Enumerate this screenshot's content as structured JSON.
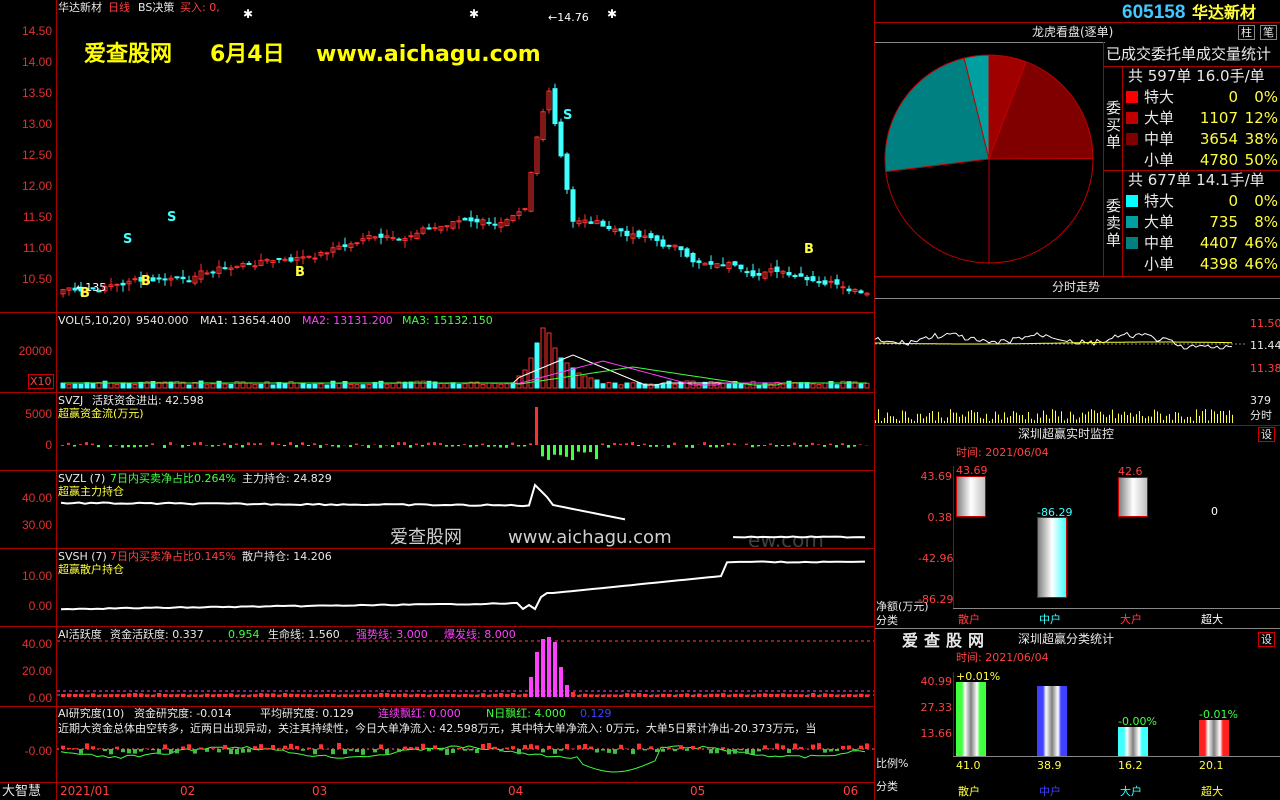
{
  "header": {
    "stock_name": "华达新材",
    "period": "日线",
    "bs_label": "BS决策",
    "buy_label": "买入: 0,",
    "code": "605158",
    "name2": "华达新材",
    "btn1": "柱",
    "btn2": "笔"
  },
  "watermark": {
    "site": "爱查股网",
    "date": "6月4日",
    "url": "www.aichagu.com",
    "mid": "爱查股网",
    "mid_url": "www.aichagu.com",
    "faint": "ew.com"
  },
  "price_axis": [
    "14.50",
    "14.00",
    "13.50",
    "13.00",
    "12.50",
    "12.00",
    "11.50",
    "11.00",
    "10.50"
  ],
  "price_high": "14.76",
  "price_low": "35",
  "marks": {
    "B": "B",
    "S": "S"
  },
  "vol": {
    "label": "VOL(5,10,20)",
    "v": "9540.000",
    "ma1": "MA1: 13654.400",
    "ma2": "MA2: 13131.200",
    "ma3": "MA3: 15132.150",
    "axis": "20000",
    "unit": "X10"
  },
  "svzj": {
    "label": "SVZJ",
    "t1": "活跃资金进出: 42.598",
    "t2": "超赢资金流(万元)",
    "axis": [
      "5000",
      "0"
    ]
  },
  "svzl": {
    "label": "SVZL (7)",
    "t1": "7日内买卖净占比0.264%",
    "t2": "主力持仓: 24.829",
    "t3": "超赢主力持仓",
    "axis": [
      "40.00",
      "30.00"
    ]
  },
  "svsh": {
    "label": "SVSH (7)",
    "t1": "7日内买卖净占比0.145%",
    "t2": "散户持仓: 14.206",
    "t3": "超赢散户持仓",
    "axis": [
      "10.00",
      "0.00"
    ]
  },
  "ai": {
    "label": "AI活跃度",
    "t1": "资金活跃度: 0.337",
    "t2": "0.954",
    "t3": "生命线: 1.560",
    "t4": "强势线: 3.000",
    "t5": "爆发线: 8.000",
    "axis": [
      "40.00",
      "20.00",
      "0.00"
    ]
  },
  "research": {
    "label": "AI研究度(10)",
    "t1": "资金研究度: -0.014",
    "t2": "平均研究度: 0.129",
    "t3": "连续飘红: 0.000",
    "t4": "N日飘红: 4.000",
    "t5": "0.129",
    "line": "近期大资金总体由空转多，近两日出现异动，关注其持续性，今日大单净流入: 42.598万元，其中特大单净流入: 0万元，大单5日累计净出-20.373万元，当",
    "axis": "-0.00"
  },
  "xaxis": {
    "corner": "大智慧",
    "labels": [
      "2021/01",
      "02",
      "03",
      "04",
      "05",
      "06"
    ]
  },
  "pie": {
    "title": "龙虎看盘(逐单)",
    "subtitle": "已成交委托单成交量统计",
    "buy": {
      "side": "委买单",
      "header": "共 597单 16.0手/单",
      "rows": [
        {
          "name": "特大",
          "n": "0",
          "p": "0%"
        },
        {
          "name": "大单",
          "n": "1107",
          "p": "12%"
        },
        {
          "name": "中单",
          "n": "3654",
          "p": "38%"
        },
        {
          "name": "小单",
          "n": "4780",
          "p": "50%"
        }
      ]
    },
    "sell": {
      "side": "委卖单",
      "header": "共 677单 14.1手/单",
      "rows": [
        {
          "name": "特大",
          "n": "0",
          "p": "0%"
        },
        {
          "name": "大单",
          "n": "735",
          "p": "8%"
        },
        {
          "name": "中单",
          "n": "4407",
          "p": "46%"
        },
        {
          "name": "小单",
          "n": "4398",
          "p": "46%"
        }
      ]
    },
    "colors": {
      "buy_big": "#a00000",
      "buy_mid": "#800000",
      "buy_small": "#000000",
      "sell_big": "#00a0a0",
      "sell_mid": "#008080",
      "sell_small": "#000000"
    }
  },
  "intraday": {
    "title": "分时走势",
    "axis": [
      "11.50",
      "11.44",
      "11.38"
    ],
    "vol_axis": "379",
    "vol_unit": "分时"
  },
  "monitor": {
    "title": "深圳超赢实时监控",
    "btn": "设",
    "time": "时间: 2021/06/04",
    "axis": [
      "43.69",
      "0.38",
      "-42.96",
      "-86.29"
    ],
    "bars": [
      {
        "cat": "散户",
        "val": "43.69",
        "n": 43.69
      },
      {
        "cat": "中户",
        "val": "-86.29",
        "n": -86.29
      },
      {
        "cat": "大户",
        "val": "42.6",
        "n": 42.6
      },
      {
        "cat": "超大",
        "val": "0",
        "n": 0
      }
    ],
    "ylabel": "净额(万元)",
    "xlabel": "分类"
  },
  "classstat": {
    "logo": "爱查股网",
    "title": "深圳超赢分类统计",
    "btn": "设",
    "time": "时间: 2021/06/04",
    "axis": [
      "40.99",
      "27.33",
      "13.66"
    ],
    "bars": [
      {
        "cat": "散户",
        "top": "+0.01%",
        "bot": "41.0",
        "n": 41.0
      },
      {
        "cat": "中户",
        "top": "",
        "bot": "38.9",
        "n": 38.9
      },
      {
        "cat": "大户",
        "top": "-0.00%",
        "bot": "16.2",
        "n": 16.2
      },
      {
        "cat": "超大",
        "top": "-0.01%",
        "bot": "20.1",
        "n": 20.1
      }
    ],
    "ylabel": "比例%",
    "xlabel": "分类"
  }
}
